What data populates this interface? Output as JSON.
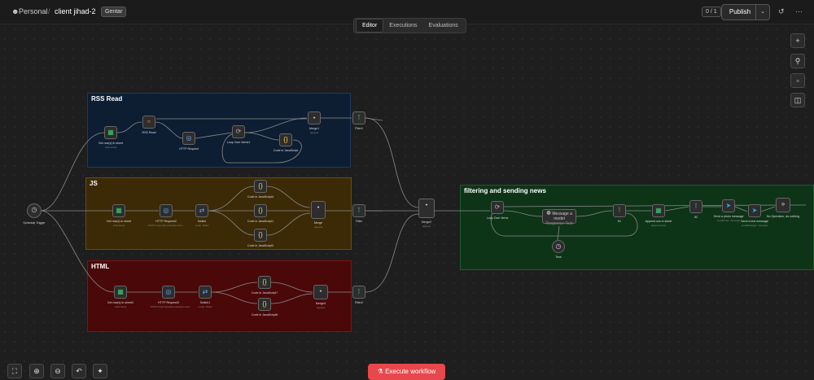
{
  "header": {
    "project": "Personal",
    "workflow": "client jihad-2",
    "tag": "Gentar",
    "counter": "0 / 1",
    "publish": "Publish"
  },
  "tabs": [
    {
      "label": "Editor"
    },
    {
      "label": "Executions"
    },
    {
      "label": "Evaluations"
    }
  ],
  "groups": {
    "rss": "RSS Read",
    "js": "JS",
    "html": "HTML",
    "filter": "filtering and sending news"
  },
  "nodes": {
    "schedule": {
      "label": "Schedule Trigger"
    },
    "rss_sheet": {
      "label": "Get row(s) in sheet",
      "sub": "rows sheet"
    },
    "rss_read": {
      "label": "RSS Read"
    },
    "rss_http": {
      "label": "HTTP Request"
    },
    "rss_loop": {
      "label": "Loop Over Items1"
    },
    "rss_code": {
      "label": "Code in JavaScript"
    },
    "rss_merge": {
      "label": "Merge1",
      "sub": "append"
    },
    "rss_filter": {
      "label": "Filter1"
    },
    "js_sheet": {
      "label": "Get row(s) in sheet",
      "sub": "rows sheet"
    },
    "js_http": {
      "label": "HTTP Request2",
      "sub": "POST: https://api.example.com/..."
    },
    "js_switch": {
      "label": "Switch",
      "sub": "mode: Rules"
    },
    "js_code4": {
      "label": "Code in JavaScript4"
    },
    "js_code1": {
      "label": "Code in JavaScript1"
    },
    "js_code3": {
      "label": "Code in JavaScript3"
    },
    "js_merge": {
      "label": "Merge",
      "sub": "append"
    },
    "js_filter": {
      "label": "Filter"
    },
    "html_sheet": {
      "label": "Get row(s) in sheet2",
      "sub": "rows sheet"
    },
    "html_http": {
      "label": "HTTP Request3",
      "sub": "POST: https://graphql.example.com/..."
    },
    "html_switch": {
      "label": "Switch1",
      "sub": "mode: Rules"
    },
    "html_code7": {
      "label": "Code in JavaScript7"
    },
    "html_code8": {
      "label": "Code in JavaScript8"
    },
    "html_merge": {
      "label": "Merge4",
      "sub": "append"
    },
    "html_filter": {
      "label": "Filter2"
    },
    "merge_main": {
      "label": "Merge2",
      "sub": "append"
    },
    "f_loop": {
      "label": "Loop Over Items"
    },
    "f_message": {
      "label": "Message a model",
      "sub": "Response Text"
    },
    "f_time": {
      "label": "Time"
    },
    "f_if": {
      "label": "If1"
    },
    "f_append": {
      "label": "Append row in sheet",
      "sub": "append sheet"
    },
    "f_if2": {
      "label": "If2"
    },
    "f_photo": {
      "label": "Send a photo message",
      "sub": "sendPhoto: message"
    },
    "f_text": {
      "label": "Send a text message",
      "sub": "sendMessage: message"
    },
    "f_noop": {
      "label": "No Operation, do nothing"
    }
  },
  "execute": "Execute workflow",
  "colors": {
    "rss_bg": "#0d1e33",
    "rss_border": "#1d3a5c",
    "js_bg": "#3b2a05",
    "js_border": "#6a4d0f",
    "html_bg": "#4b0809",
    "html_border": "#7a1416",
    "filter_bg": "#0e3418",
    "filter_border": "#1f5a2d",
    "exec": "#e8484b"
  }
}
